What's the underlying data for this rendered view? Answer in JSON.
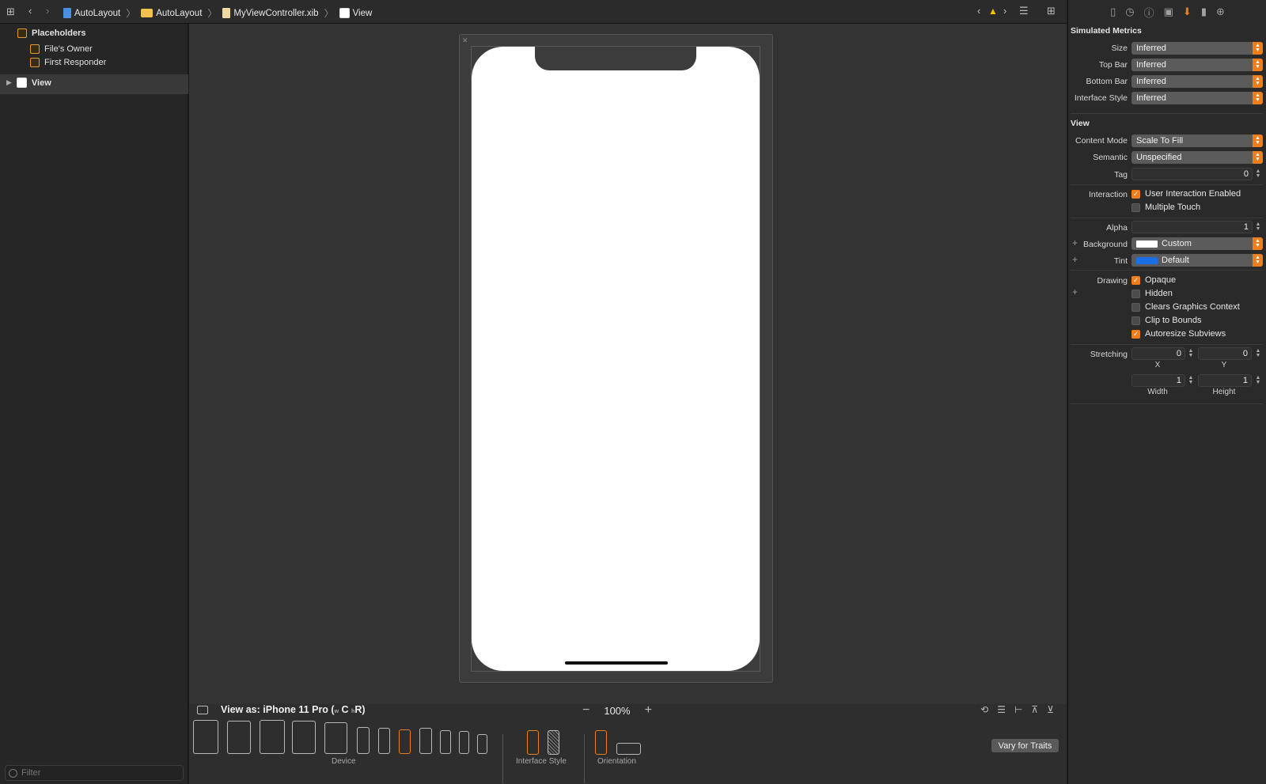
{
  "topbar": {
    "breadcrumbs": [
      {
        "label": "AutoLayout",
        "icon": "project-file-icon"
      },
      {
        "label": "AutoLayout",
        "icon": "folder-icon"
      },
      {
        "label": "MyViewController.xib",
        "icon": "xib-file-icon"
      },
      {
        "label": "View",
        "icon": "view-icon"
      }
    ]
  },
  "navigator": {
    "placeholders": "Placeholders",
    "files_owner": "File's Owner",
    "first_responder": "First Responder",
    "view": "View",
    "filter_placeholder": "Filter"
  },
  "canvas": {
    "view_as": "View as: iPhone 11 Pro (",
    "view_as_w": "w",
    "view_as_c": "C",
    "view_as_h": "h",
    "view_as_r": "R)",
    "zoom": "100%",
    "device_label": "Device",
    "interface_style_label": "Interface Style",
    "orientation_label": "Orientation",
    "vary_button": "Vary for Traits"
  },
  "inspector": {
    "simulated_metrics": {
      "title": "Simulated Metrics",
      "size_label": "Size",
      "size_value": "Inferred",
      "topbar_label": "Top Bar",
      "topbar_value": "Inferred",
      "bottombar_label": "Bottom Bar",
      "bottombar_value": "Inferred",
      "style_label": "Interface Style",
      "style_value": "Inferred"
    },
    "view": {
      "title": "View",
      "content_mode_label": "Content Mode",
      "content_mode_value": "Scale To Fill",
      "semantic_label": "Semantic",
      "semantic_value": "Unspecified",
      "tag_label": "Tag",
      "tag_value": "0",
      "interaction_label": "Interaction",
      "user_interaction": "User Interaction Enabled",
      "multiple_touch": "Multiple Touch",
      "alpha_label": "Alpha",
      "alpha_value": "1",
      "background_label": "Background",
      "background_value": "Custom",
      "tint_label": "Tint",
      "tint_value": "Default",
      "drawing_label": "Drawing",
      "opaque": "Opaque",
      "hidden": "Hidden",
      "clears": "Clears Graphics Context",
      "clip": "Clip to Bounds",
      "autoresize": "Autoresize Subviews",
      "stretching_label": "Stretching",
      "stretch_x": "0",
      "stretch_y": "0",
      "stretch_w": "1",
      "stretch_h": "1",
      "x_label": "X",
      "y_label": "Y",
      "width_label": "Width",
      "height_label": "Height"
    },
    "checks": {
      "user_interaction": true,
      "multiple_touch": false,
      "opaque": true,
      "hidden": false,
      "clears": false,
      "clip": false,
      "autoresize": true
    },
    "colors": {
      "background_swatch": "#ffffff",
      "tint_swatch": "#1a6fe6"
    }
  },
  "colors": {
    "accent": "#ef7d1a",
    "canvas": "#333333",
    "panel": "#2a2a2a"
  }
}
